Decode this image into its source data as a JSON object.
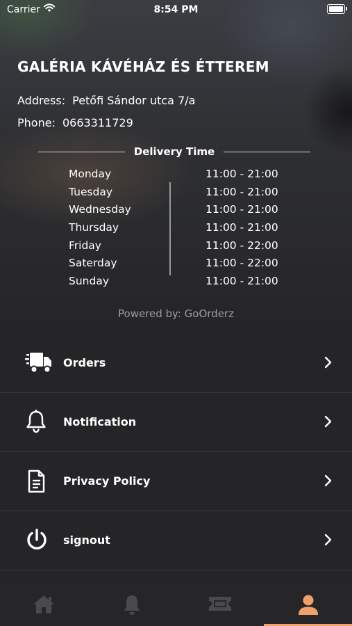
{
  "status": {
    "carrier": "Carrier",
    "time": "8:54 PM"
  },
  "restaurant": {
    "name": "GALÉRIA KÁVÉHÁZ ÉS ÉTTEREM",
    "address_label": "Address:",
    "address": "Petőfi Sándor utca 7/a",
    "phone_label": "Phone:",
    "phone": "0663311729"
  },
  "delivery": {
    "title": "Delivery Time",
    "hours": [
      {
        "day": "Monday",
        "time": "11:00 - 21:00"
      },
      {
        "day": "Tuesday",
        "time": "11:00 - 21:00"
      },
      {
        "day": "Wednesday",
        "time": "11:00 - 21:00"
      },
      {
        "day": "Thursday",
        "time": "11:00 - 21:00"
      },
      {
        "day": "Friday",
        "time": "11:00 - 22:00"
      },
      {
        "day": "Saterday",
        "time": "11:00 - 22:00"
      },
      {
        "day": "Sunday",
        "time": "11:00 - 21:00"
      }
    ]
  },
  "powered_by": "Powered by: GoOrderz",
  "menu": [
    {
      "label": "Orders",
      "icon": "truck-icon"
    },
    {
      "label": "Notification",
      "icon": "bell-icon"
    },
    {
      "label": "Privacy Policy",
      "icon": "document-icon"
    },
    {
      "label": "signout",
      "icon": "power-icon"
    }
  ],
  "tabbar": {
    "tabs": [
      {
        "icon": "home-icon",
        "active": false
      },
      {
        "icon": "bell-icon",
        "active": false
      },
      {
        "icon": "ticket-icon",
        "active": false
      },
      {
        "icon": "user-icon",
        "active": true
      }
    ],
    "active_color": "#f0a06a",
    "inactive_color": "#4a4a4e"
  }
}
